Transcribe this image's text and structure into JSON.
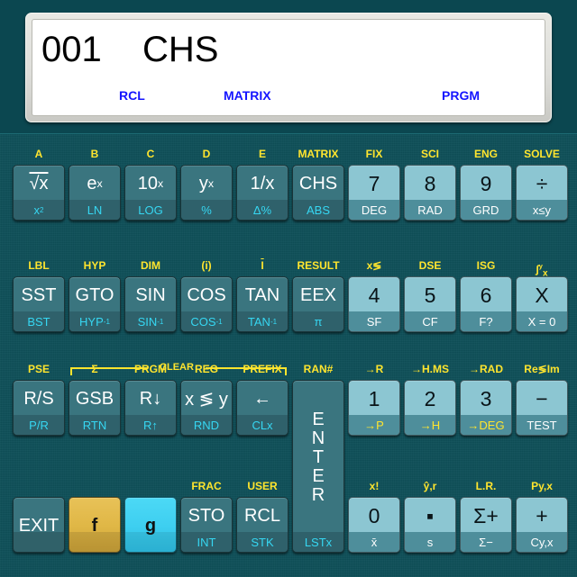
{
  "display": {
    "step": "001",
    "mnemonic": "CHS",
    "annunciators": [
      "RCL",
      "MATRIX",
      "PRGM"
    ],
    "lcd_color": "#ffffff",
    "annunciator_color": "#1414ff",
    "text_color": "#000000"
  },
  "colors": {
    "faceplate": "#0d4f58",
    "function_key": "#3a757f",
    "numeric_key": "#8cc6d2",
    "f_shift": "#e0b746",
    "g_shift": "#3ecff0",
    "gold_legend": "#ffe52e",
    "cyan_legend": "#36d7f2",
    "bezel": "#dededa"
  },
  "clear_bracket": {
    "label": "CLEAR"
  },
  "keyboard": {
    "rows": [
      {
        "name": "row-1",
        "keys": [
          {
            "name": "sqrt",
            "top": "A",
            "primary": "√x",
            "primary_html": "<span class=\"ovl\">√x</span>",
            "secondary": "x²",
            "secondary_html": "x<sup>2</sup>",
            "style": "fn"
          },
          {
            "name": "e-to-x",
            "top": "B",
            "primary": "eˣ",
            "primary_html": "e<sup>x</sup>",
            "secondary": "LN",
            "style": "fn"
          },
          {
            "name": "ten-to-x",
            "top": "C",
            "primary": "10ˣ",
            "primary_html": "10<sup>x</sup>",
            "secondary": "LOG",
            "style": "fn"
          },
          {
            "name": "y-to-x",
            "top": "D",
            "primary": "yˣ",
            "primary_html": "y<sup>x</sup>",
            "secondary": "%",
            "style": "fn"
          },
          {
            "name": "reciprocal",
            "top": "E",
            "primary": "1/x",
            "secondary": "Δ%",
            "style": "fn"
          },
          {
            "name": "chs",
            "top": "MATRIX",
            "primary": "CHS",
            "secondary": "ABS",
            "style": "fn"
          },
          {
            "name": "digit-7",
            "top": "FIX",
            "primary": "7",
            "secondary": "DEG",
            "style": "num"
          },
          {
            "name": "digit-8",
            "top": "SCI",
            "primary": "8",
            "secondary": "RAD",
            "style": "num"
          },
          {
            "name": "digit-9",
            "top": "ENG",
            "primary": "9",
            "secondary": "GRD",
            "style": "num"
          },
          {
            "name": "divide",
            "top": "SOLVE",
            "primary": "÷",
            "secondary": "x≤y",
            "style": "num"
          }
        ]
      },
      {
        "name": "row-2",
        "keys": [
          {
            "name": "sst",
            "top": "LBL",
            "primary": "SST",
            "secondary": "BST",
            "style": "fn"
          },
          {
            "name": "gto",
            "top": "HYP",
            "primary": "GTO",
            "secondary": "HYP⁻¹",
            "secondary_html": "HYP<sup>-1</sup>",
            "style": "fn"
          },
          {
            "name": "sin",
            "top": "DIM",
            "primary": "SIN",
            "secondary": "SIN⁻¹",
            "secondary_html": "SIN<sup>-1</sup>",
            "style": "fn"
          },
          {
            "name": "cos",
            "top": "(i)",
            "primary": "COS",
            "secondary": "COS⁻¹",
            "secondary_html": "COS<sup>-1</sup>",
            "style": "fn"
          },
          {
            "name": "tan",
            "top": "I",
            "top_html": "<span class=\"ovl\">I</span>",
            "primary": "TAN",
            "secondary": "TAN⁻¹",
            "secondary_html": "TAN<sup>-1</sup>",
            "style": "fn"
          },
          {
            "name": "eex",
            "top": "RESULT",
            "primary": "EEX",
            "secondary": "π",
            "style": "fn"
          },
          {
            "name": "digit-4",
            "top": "x≶",
            "primary": "4",
            "secondary": "SF",
            "style": "num"
          },
          {
            "name": "digit-5",
            "top": "DSE",
            "primary": "5",
            "secondary": "CF",
            "style": "num"
          },
          {
            "name": "digit-6",
            "top": "ISG",
            "primary": "6",
            "secondary": "F?",
            "style": "num"
          },
          {
            "name": "multiply-x",
            "top": "∫ʸₓ",
            "top_html": "∫<sup>y</sup><sub>x</sub>",
            "primary": "X",
            "secondary": "X = 0",
            "style": "num"
          }
        ]
      },
      {
        "name": "row-3",
        "keys": [
          {
            "name": "run-stop",
            "top": "PSE",
            "primary": "R/S",
            "secondary": "P/R",
            "style": "fn"
          },
          {
            "name": "gsb",
            "top": "Σ",
            "primary": "GSB",
            "secondary": "RTN",
            "style": "fn"
          },
          {
            "name": "roll-down",
            "top": "PRGM",
            "primary": "R↓",
            "secondary": "R↑",
            "style": "fn"
          },
          {
            "name": "x-exchange-y",
            "top": "REG",
            "primary": "x ≶ y",
            "secondary": "RND",
            "style": "fn"
          },
          {
            "name": "backspace",
            "top": "PREFIX",
            "primary": "←",
            "secondary": "CLx",
            "style": "fn"
          },
          {
            "name": "enter",
            "top": "RAN#",
            "primary": "ENTER",
            "secondary": "LSTx",
            "style": "fn",
            "tall": true
          },
          {
            "name": "digit-1",
            "top": "→R",
            "primary": "1",
            "secondary": "→P",
            "secondary_gold": true,
            "style": "num"
          },
          {
            "name": "digit-2",
            "top": "→H.MS",
            "primary": "2",
            "secondary": "→H",
            "secondary_gold": true,
            "style": "num"
          },
          {
            "name": "digit-3",
            "top": "→RAD",
            "primary": "3",
            "secondary": "→DEG",
            "secondary_gold": true,
            "style": "num"
          },
          {
            "name": "subtract",
            "top": "Re≶Im",
            "primary": "−",
            "secondary": "TEST",
            "style": "num"
          }
        ]
      },
      {
        "name": "row-4",
        "keys": [
          {
            "name": "exit",
            "top": "",
            "primary": "EXIT",
            "secondary": "",
            "style": "plain"
          },
          {
            "name": "f-shift",
            "top": "",
            "primary": "f",
            "secondary": "",
            "style": "gold"
          },
          {
            "name": "g-shift",
            "top": "",
            "primary": "g",
            "secondary": "",
            "style": "cyan"
          },
          {
            "name": "sto",
            "top": "FRAC",
            "primary": "STO",
            "secondary": "INT",
            "style": "fn"
          },
          {
            "name": "rcl",
            "top": "USER",
            "primary": "RCL",
            "secondary": "STK",
            "style": "fn"
          },
          {
            "name": "enter-spacer",
            "top": "",
            "primary": "",
            "secondary": "",
            "style": "spacer"
          },
          {
            "name": "digit-0",
            "top": "x!",
            "primary": "0",
            "secondary": "x̄",
            "style": "num"
          },
          {
            "name": "decimal-point",
            "top": "ŷ,r",
            "primary": "▪",
            "secondary": "s",
            "style": "num"
          },
          {
            "name": "sigma-plus",
            "top": "L.R.",
            "primary": "Σ+",
            "secondary": "Σ−",
            "style": "num"
          },
          {
            "name": "add",
            "top": "Py,x",
            "primary": "+",
            "secondary": "Cy,x",
            "style": "num"
          }
        ]
      }
    ]
  }
}
